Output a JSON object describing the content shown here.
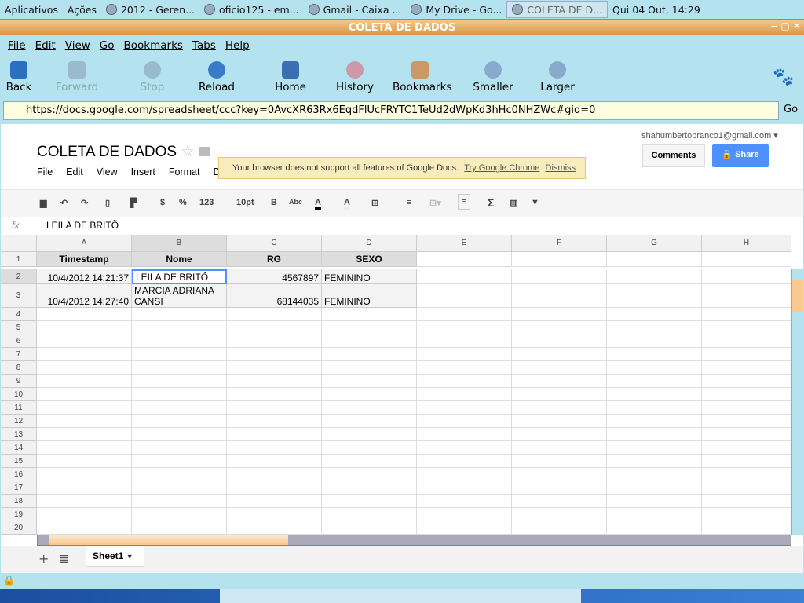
{
  "panel": {
    "apps": "Aplicativos",
    "actions": "Ações",
    "tasks": [
      "2012 - Geren...",
      "oficio125 - em...",
      "Gmail - Caixa ...",
      "My Drive - Go...",
      "COLETA DE D..."
    ],
    "clock": "Qui 04 Out, 14:29"
  },
  "window": {
    "title": "COLETA DE DADOS"
  },
  "menu": [
    "File",
    "Edit",
    "View",
    "Go",
    "Bookmarks",
    "Tabs",
    "Help"
  ],
  "nav": {
    "back": "Back",
    "forward": "Forward",
    "stop": "Stop",
    "reload": "Reload",
    "home": "Home",
    "history": "History",
    "bookmarks": "Bookmarks",
    "smaller": "Smaller",
    "larger": "Larger"
  },
  "url": "https://docs.google.com/spreadsheet/ccc?key=0AvcXR63Rx6EqdFlUcFRYTC1TeUd2dWpKd3hHc0NHZWc#gid=0",
  "go": "Go",
  "doc": {
    "title": "COLETA DE DADOS",
    "menu": [
      "File",
      "Edit",
      "View",
      "Insert",
      "Format",
      "D"
    ],
    "email": "shahumbertobranco1@gmail.com",
    "comments": "Comments",
    "share": "Share",
    "notice": {
      "text": "Your browser does not support all features of Google Docs.",
      "chrome": "Try Google Chrome",
      "dismiss": "Dismiss"
    }
  },
  "toolbar": {
    "currency": "$",
    "percent": "%",
    "number": "123",
    "fontsize": "10pt",
    "bold": "B",
    "strike": "Abc",
    "textcolor": "A",
    "fillcolor": "A",
    "sum": "Σ"
  },
  "formula": {
    "fx": "fx",
    "value": "LEILA DE BRITÕ"
  },
  "columns": [
    "A",
    "B",
    "C",
    "D",
    "E",
    "F",
    "G",
    "H"
  ],
  "rows": [
    [
      "Timestamp",
      "Nome",
      "RG",
      "SEXO"
    ],
    [
      "10/4/2012 14:21:37",
      "LEILA DE BRITÕ",
      "4567897",
      "FEMININO"
    ],
    [
      "10/4/2012 14:27:40",
      "MARCIA ADRIANA CANSI",
      "68144035",
      "FEMININO"
    ]
  ],
  "sheet_tab": "Sheet1",
  "colors": {
    "accent": "#4d90fe",
    "chrome": "#b4e2ef",
    "title": "#d89548"
  }
}
